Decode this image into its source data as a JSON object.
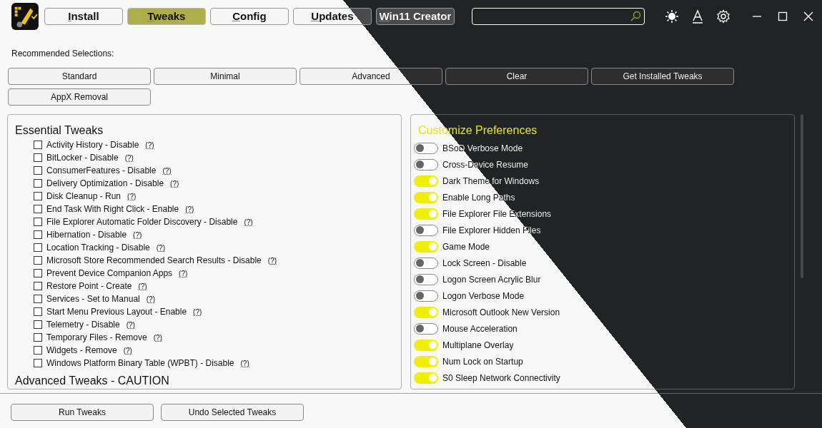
{
  "tabs": [
    {
      "label": "Install",
      "selected": false
    },
    {
      "label": "Tweaks",
      "selected": true
    },
    {
      "label": "Config",
      "selected": false
    },
    {
      "label": "Updates",
      "selected": false
    },
    {
      "label": "Win11 Creator",
      "selected": false
    }
  ],
  "recommended_label": "Recommended Selections:",
  "presets": [
    "Standard",
    "Minimal",
    "Advanced",
    "Clear",
    "Get Installed Tweaks",
    "AppX Removal"
  ],
  "tweaks_panel": {
    "sections": [
      {
        "title": "Essential Tweaks",
        "items": [
          {
            "label": "Activity History - Disable",
            "help": "(?)",
            "checked": false
          },
          {
            "label": "BitLocker - Disable",
            "help": "(?)",
            "checked": false
          },
          {
            "label": "ConsumerFeatures - Disable",
            "help": "(?)",
            "checked": false
          },
          {
            "label": "Delivery Optimization - Disable",
            "help": "(?)",
            "checked": false
          },
          {
            "label": "Disk Cleanup - Run",
            "help": "(?)",
            "checked": false
          },
          {
            "label": "End Task With Right Click - Enable",
            "help": "(?)",
            "checked": false
          },
          {
            "label": "File Explorer Automatic Folder Discovery - Disable",
            "help": "(?)",
            "checked": false
          },
          {
            "label": "Hibernation - Disable",
            "help": "(?)",
            "checked": false
          },
          {
            "label": "Location Tracking - Disable",
            "help": "(?)",
            "checked": false
          },
          {
            "label": "Microsoft Store Recommended Search Results - Disable",
            "help": "(?)",
            "checked": false
          },
          {
            "label": "Prevent Device Companion Apps",
            "help": "(?)",
            "checked": false
          },
          {
            "label": "Restore Point - Create",
            "help": "(?)",
            "checked": false
          },
          {
            "label": "Services - Set to Manual",
            "help": "(?)",
            "checked": false
          },
          {
            "label": "Start Menu Previous Layout - Enable",
            "help": "(?)",
            "checked": false
          },
          {
            "label": "Telemetry - Disable",
            "help": "(?)",
            "checked": false
          },
          {
            "label": "Temporary Files - Remove",
            "help": "(?)",
            "checked": false
          },
          {
            "label": "Widgets - Remove",
            "help": "(?)",
            "checked": false
          },
          {
            "label": "Windows Platform Binary Table (WPBT) - Disable",
            "help": "(?)",
            "checked": false
          }
        ]
      },
      {
        "title": "Advanced Tweaks - CAUTION"
      }
    ]
  },
  "preferences_panel": {
    "title": "Customize Preferences",
    "items": [
      {
        "label": "BSoD Verbose Mode",
        "on": false
      },
      {
        "label": "Cross-Device Resume",
        "on": false
      },
      {
        "label": "Dark Theme for Windows",
        "on": true
      },
      {
        "label": "Enable Long Paths",
        "on": true
      },
      {
        "label": "File Explorer File Extensions",
        "on": true
      },
      {
        "label": "File Explorer Hidden Files",
        "on": false
      },
      {
        "label": "Game Mode",
        "on": true
      },
      {
        "label": "Lock Screen - Disable",
        "on": false
      },
      {
        "label": "Logon Screen Acrylic Blur",
        "on": false
      },
      {
        "label": "Logon Verbose Mode",
        "on": false
      },
      {
        "label": "Microsoft Outlook New Version",
        "on": true
      },
      {
        "label": "Mouse Acceleration",
        "on": false
      },
      {
        "label": "Multiplane Overlay",
        "on": true
      },
      {
        "label": "Num Lock on Startup",
        "on": true
      },
      {
        "label": "S0 Sleep Network Connectivity",
        "on": true
      }
    ]
  },
  "bottom_buttons": [
    "Run Tweaks",
    "Undo Selected Tweaks"
  ]
}
